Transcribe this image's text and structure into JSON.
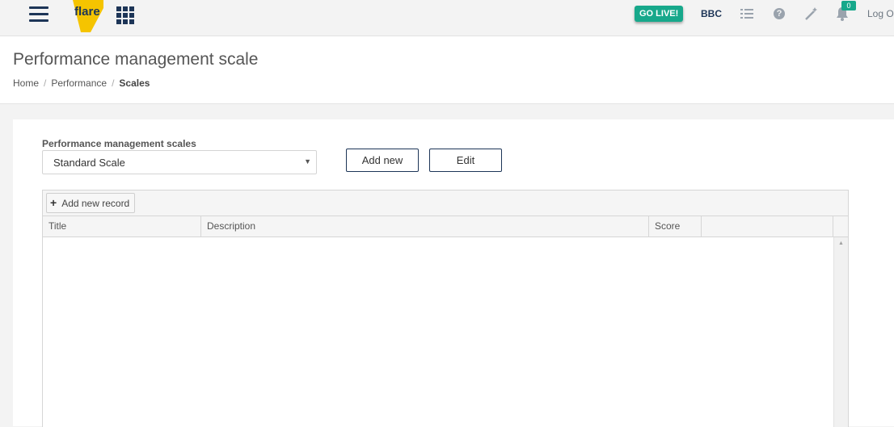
{
  "topbar": {
    "logo_text": "flare",
    "golive_label": "GO LIVE!",
    "company": "BBC",
    "notification_count": "0",
    "logout_label": "Log O",
    "icons": [
      "menu-icon",
      "apps-grid-icon",
      "list-icon",
      "help-icon",
      "magic-wand-icon",
      "bell-icon"
    ],
    "colors": {
      "accent": "#17a88b",
      "navy": "#1d3557",
      "logo_yellow": "#f5c400"
    }
  },
  "header": {
    "title": "Performance management scale",
    "breadcrumb": [
      "Home",
      "Performance",
      "Scales"
    ]
  },
  "form": {
    "select_label": "Performance management scales",
    "select_value": "Standard Scale",
    "add_new_label": "Add new",
    "edit_label": "Edit"
  },
  "grid": {
    "add_record_label": "Add new record",
    "columns": [
      "Title",
      "Description",
      "Score",
      ""
    ],
    "rows": []
  }
}
